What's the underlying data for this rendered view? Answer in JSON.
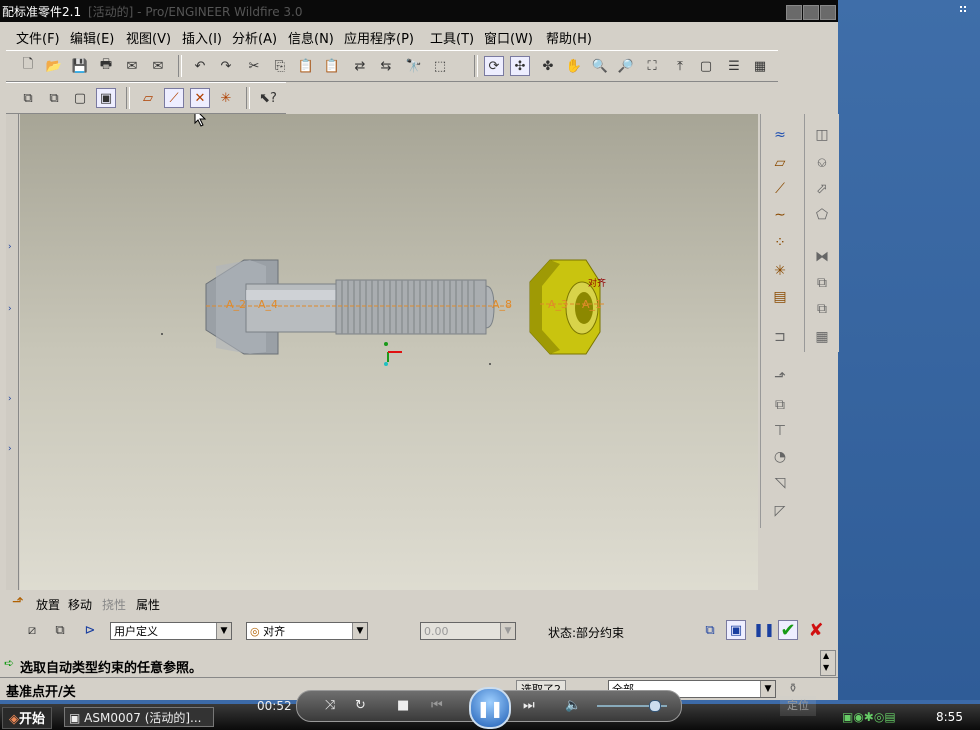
{
  "window": {
    "title_overlay": "配标准零件2.1",
    "title": "[活动的] - Pro/ENGINEER Wildfire 3.0"
  },
  "menu": [
    "文件(F)",
    "编辑(E)",
    "视图(V)",
    "插入(I)",
    "分析(A)",
    "信息(N)",
    "应用程序(P)",
    "工具(T)",
    "窗口(W)",
    "帮助(H)"
  ],
  "toolbar1_icons": [
    "new-icon",
    "open-icon",
    "save-icon",
    "print-icon",
    "email-icon",
    "email-link-icon",
    "undo-icon",
    "redo-icon",
    "cut-icon",
    "copy-icon",
    "paste-icon",
    "paste-special-icon",
    "regenerate-icon",
    "regen-manager-icon",
    "find-icon",
    "select-box-icon",
    "repaint-icon",
    "spin-center-icon",
    "orient-icon",
    "pan-icon",
    "zoom-in-icon",
    "zoom-out-icon",
    "refit-icon",
    "reorient-icon",
    "saved-views-icon",
    "layers-icon",
    "model-display-icon"
  ],
  "model": {
    "datum_labels": [
      "A_2",
      "A_4",
      "A_8",
      "A_3",
      "A_1"
    ],
    "constraint_label": "对齐"
  },
  "dashboard": {
    "tabs": [
      "放置",
      "移动",
      "挠性",
      "属性"
    ],
    "constraint_set": "用户定义",
    "constraint_type": "对齐",
    "offset": "0.00",
    "status": "状态:部分约束"
  },
  "message": "选取自动类型约束的任意参照。",
  "status_bar": {
    "left": "基准点开/关",
    "selected": "选取了2",
    "filter": "全部",
    "ghost": "定位"
  },
  "taskbar": {
    "start": "开始",
    "task": "ASM0007 (活动的]...",
    "time": "8:55"
  },
  "player": {
    "time": "00:52"
  },
  "colors": {
    "viewport_top": "#a7a596",
    "bolt": "#b8bcbf",
    "nut": "#c9c40f",
    "datum": "#e08a2a",
    "ok_green": "#169a16",
    "cancel_red": "#d01010"
  }
}
